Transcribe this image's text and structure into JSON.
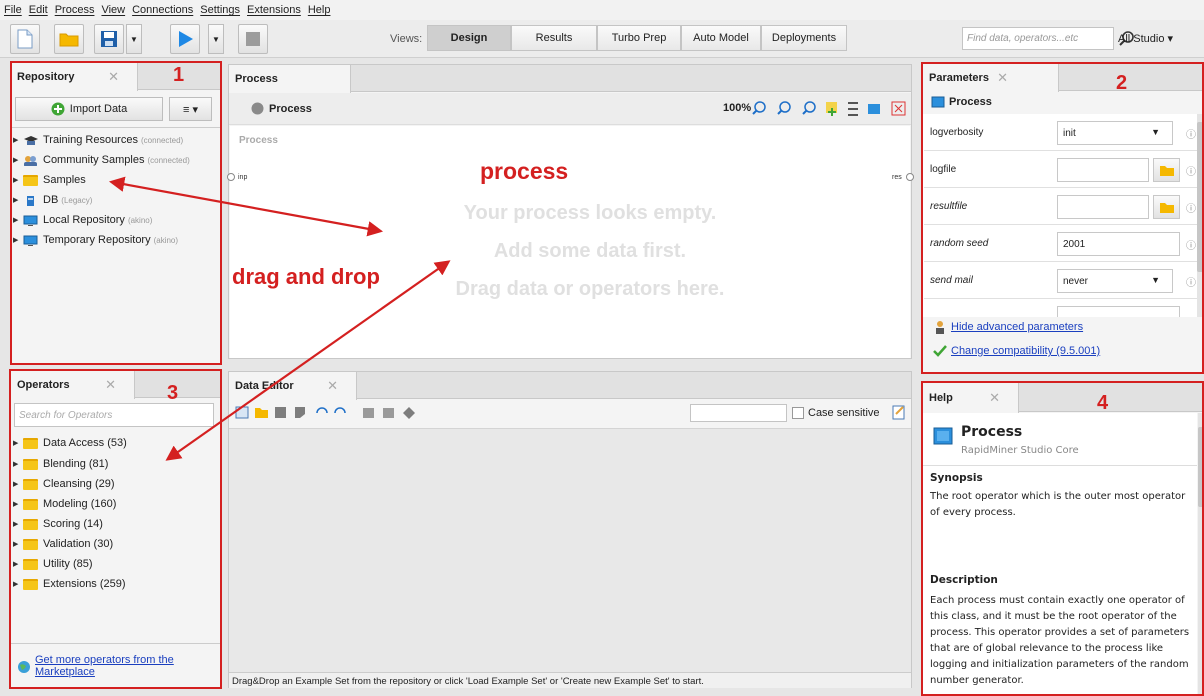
{
  "menu": [
    "File",
    "Edit",
    "Process",
    "View",
    "Connections",
    "Settings",
    "Extensions",
    "Help"
  ],
  "toolbar": {
    "views_label": "Views:",
    "view_tabs": [
      "Design",
      "Results",
      "Turbo Prep",
      "Auto Model",
      "Deployments"
    ],
    "active_view": "Design",
    "search_placeholder": "Find data, operators...etc",
    "studio_selector": "All Studio ▾"
  },
  "repository": {
    "tab": "Repository",
    "import_button": "Import Data",
    "menu_button": "≡ ▾",
    "items": [
      {
        "label": "Training Resources",
        "sub": "(connected)"
      },
      {
        "label": "Community Samples",
        "sub": "(connected)"
      },
      {
        "label": "Samples",
        "sub": ""
      },
      {
        "label": "DB",
        "sub": "(Legacy)"
      },
      {
        "label": "Local Repository",
        "sub": "(akino)"
      },
      {
        "label": "Temporary Repository",
        "sub": "(akino)"
      }
    ]
  },
  "process": {
    "tab": "Process",
    "breadcrumb": "Process",
    "zoom": "100%",
    "canvas_title": "Process",
    "port_in": "inp",
    "port_out": "res",
    "empty_lines": [
      "Your process looks empty.",
      "Add some data first.",
      "Drag data or operators here."
    ]
  },
  "parameters": {
    "tab": "Parameters",
    "operator": "Process",
    "rows": [
      {
        "label": "logverbosity",
        "value": "init",
        "kind": "select",
        "italic": false
      },
      {
        "label": "logfile",
        "value": "",
        "kind": "file",
        "italic": false
      },
      {
        "label": "resultfile",
        "value": "",
        "kind": "file",
        "italic": true
      },
      {
        "label": "random seed",
        "value": "2001",
        "kind": "text",
        "italic": true
      },
      {
        "label": "send mail",
        "value": "never",
        "kind": "select",
        "italic": true
      }
    ],
    "hide_advanced": "Hide advanced parameters",
    "change_compat": "Change compatibility (9.5.001)"
  },
  "operators": {
    "tab": "Operators",
    "search_placeholder": "Search for Operators",
    "items": [
      "Data Access (53)",
      "Blending (81)",
      "Cleansing (29)",
      "Modeling (160)",
      "Scoring (14)",
      "Validation (30)",
      "Utility (85)",
      "Extensions (259)"
    ],
    "marketplace_link_1": "Get more operators from the",
    "marketplace_link_2": "Marketplace"
  },
  "data_editor": {
    "tab": "Data Editor",
    "case_sensitive": "Case sensitive",
    "status": "Drag&Drop an Example Set from the repository or click 'Load Example Set' or 'Create new Example Set' to start."
  },
  "help": {
    "tab": "Help",
    "title": "Process",
    "subtitle": "RapidMiner Studio Core",
    "synopsis_heading": "Synopsis",
    "synopsis": [
      "The root operator which is the outer most operator",
      "of every process."
    ],
    "description_heading": "Description",
    "description": [
      "Each process must contain exactly one operator of",
      "this class, and it must be the root operator of the",
      "process. This operator provides a set of parameters",
      "that are of global relevance to the process like",
      "logging and initialization parameters of the random",
      "number generator."
    ]
  },
  "annotations": {
    "n1": "1",
    "n2": "2",
    "n3": "3",
    "n4": "4",
    "process": "process",
    "drag_and_drop": "drag and drop",
    "color": "#d42020"
  }
}
